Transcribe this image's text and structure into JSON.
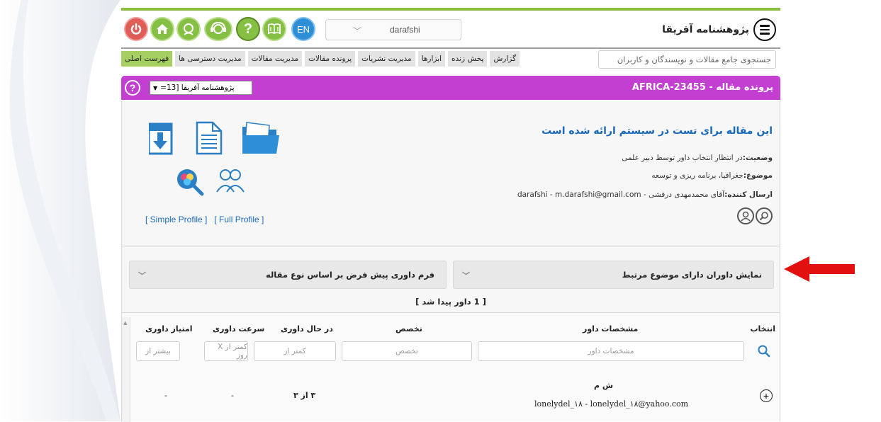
{
  "toolbar": {
    "icons": [
      "power-icon",
      "home-icon",
      "user-head-icon",
      "support-headset-icon",
      "help-icon",
      "book-icon"
    ],
    "language_button": "EN",
    "user_select_value": "darafshi",
    "brand_title": "پژوهشنامه آفریقا"
  },
  "menu": {
    "items": [
      "فهرست اصلی",
      "مدیریت دسترسی ها",
      "مدیریت مقالات",
      "پرونده مقالات",
      "مدیریت نشریات",
      "ابزارها",
      "پخش زنده",
      "گزارش"
    ],
    "active_index": 0,
    "search_placeholder": "جستجوی جامع مقالات و نویسندگان و کاربران"
  },
  "case_bar": {
    "title": "پرونده مقاله - AFRICA-23455",
    "journal_select_value": "پژوهشنامه آفریقا [13=",
    "help_label": "?",
    "color": "#c33fd2"
  },
  "paper": {
    "title": "این مقاله برای تست در سیستم ارائه شده است",
    "status_label": "وضعیت:",
    "status_value": "در انتظار انتخاب داور توسط دبیر علمی",
    "subject_label": "موضوع:",
    "subject_value": "جغرافیا، برنامه ریزی و توسعه",
    "sender_label": "ارسال کننده:",
    "sender_value": "آقای محمدمهدی درفشی - darafshi - m.darafshi@gmail.com",
    "simple_profile": "[ Simple Profile ]",
    "full_profile": "[ Full Profile ]"
  },
  "dropdowns": {
    "reviewers_by_subject": "نمایش داوران دارای موضوع مرتبط",
    "default_review_form": "فرم داوری پیش فرض بر اساس نوع مقاله"
  },
  "reviewers": {
    "found_text": "[ 1 داور پیدا شد ]",
    "columns": {
      "select": "انتخاب",
      "reviewer_info": "مشخصات داور",
      "expertise": "تخصص",
      "in_review": "در حال داوری",
      "review_speed": "سرعت داوری",
      "review_score": "امتیاز داوری"
    },
    "filters": {
      "reviewer_info": "مشخصات داور",
      "expertise": "تخصص",
      "in_review": "کمتر از",
      "review_speed": "کمتر از X روز",
      "review_score": "بیشتر از"
    },
    "rows": [
      {
        "name": "ش م",
        "contact": "lonelydel_۱۸ - lonelydel_۱۸@yahoo.com",
        "in_review": "۳ از ۳",
        "review_speed": "-",
        "review_score": "-"
      }
    ]
  },
  "colors": {
    "accent_green": "#85c044",
    "active_menu": "#a6cf61",
    "link_blue": "#1a68b8",
    "arrow_red": "#e31010"
  }
}
